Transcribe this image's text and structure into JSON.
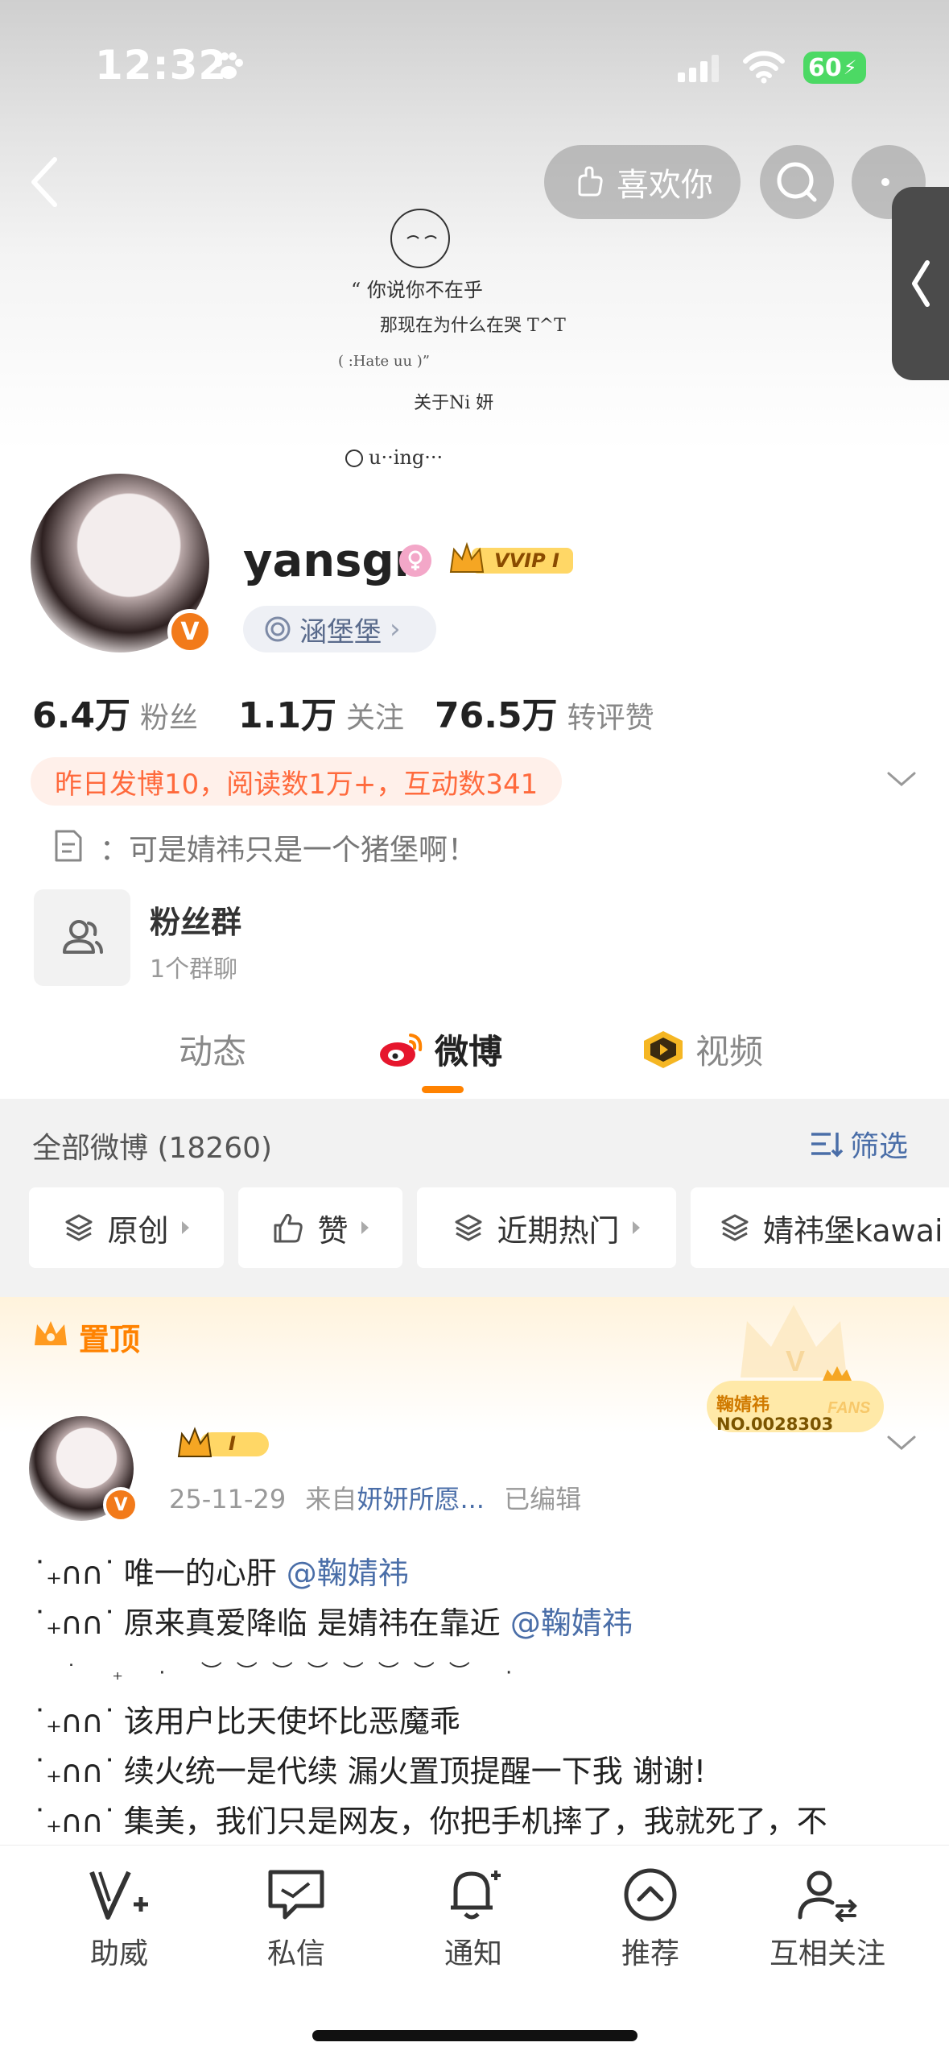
{
  "status_bar": {
    "time": "12:32",
    "battery": "60"
  },
  "header": {
    "like_button": "喜欢你"
  },
  "cover_text": {
    "line1": "“ 你说你不在乎",
    "line2": "那现在为什么在哭 T^T",
    "line3": "( :Hate uu )”",
    "line4": "关于Ni 妍",
    "line5": "u··ing···"
  },
  "profile": {
    "username": "yansgr",
    "vip_label": "VVIP I",
    "avatar_badge": "V",
    "community": "涵堡堡",
    "stats": [
      {
        "value": "6.4万",
        "label": "粉丝"
      },
      {
        "value": "1.1万",
        "label": "关注"
      },
      {
        "value": "76.5万",
        "label": "转评赞"
      }
    ],
    "activity": "昨日发博10，阅读数1万+，互动数341",
    "bio": "：可是婧祎只是一个猪堡啊！",
    "fan_group": {
      "title": "粉丝群",
      "subtitle": "1个群聊"
    }
  },
  "tabs": [
    {
      "label": "动态"
    },
    {
      "label": "微博"
    },
    {
      "label": "视频"
    }
  ],
  "posts_filter": {
    "total": "全部微博 (18260)",
    "filter_label": "筛选",
    "chips": [
      "原创",
      "赞",
      "近期热门",
      "婧祎堡kawai"
    ]
  },
  "pinned": {
    "label": "置顶",
    "fans_card_name": "鞠婧祎",
    "fans_card_no": "NO.0028303",
    "fans_card_word": "FANS"
  },
  "post": {
    "vip_label": "I",
    "date": "25-11-29",
    "source_prefix": "来自",
    "source": "妍妍所愿...",
    "edited": "已编辑",
    "deco": "˙₊∩∩˙",
    "lines": [
      {
        "text": "唯一的心肝",
        "mention": "@鞠婧祎"
      },
      {
        "text": "原来真爱降临 是婧祎在靠近",
        "mention": "@鞠婧祎"
      },
      {
        "text": "该用户比天使坏比恶魔乖",
        "mention": ""
      },
      {
        "text": "续火统一是代续 漏火置顶提醒一下我 谢谢!",
        "mention": ""
      },
      {
        "text": "集美，我们只是网友，你把手机摔了，我就死了，不",
        "mention": ""
      }
    ],
    "sparkle_row": "˙ ₊ · ︶︶︶︶︶︶︶︶ ·"
  },
  "bottom_nav": [
    {
      "label": "助威",
      "icon": "v-plus-icon"
    },
    {
      "label": "私信",
      "icon": "chat-icon"
    },
    {
      "label": "通知",
      "icon": "bell-icon"
    },
    {
      "label": "推荐",
      "icon": "chevron-up-circle-icon"
    },
    {
      "label": "互相关注",
      "icon": "user-follow-icon"
    }
  ]
}
